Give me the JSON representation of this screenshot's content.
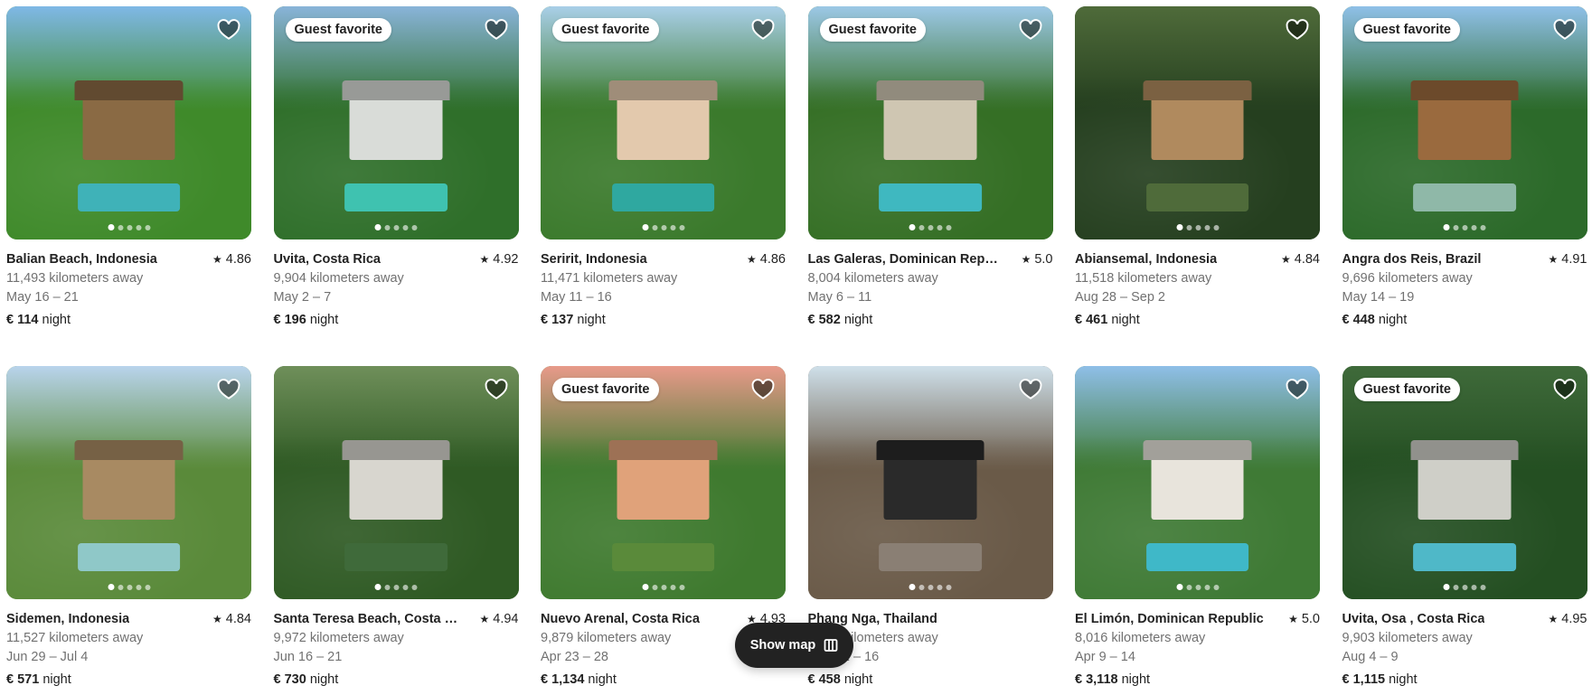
{
  "listings": [
    {
      "title": "Balian Beach, Indonesia",
      "rating": "4.86",
      "distance": "11,493 kilometers away",
      "dates": "May 16 – 21",
      "price": "€ 114",
      "price_unit": "night",
      "badge": "",
      "colors": {
        "sky": "#7fb8e6",
        "canopy": "#3f8a2a",
        "house": "#8a6a44",
        "pool": "#3fb2b8"
      }
    },
    {
      "title": "Uvita, Costa Rica",
      "rating": "4.92",
      "distance": "9,904 kilometers away",
      "dates": "May 2 – 7",
      "price": "€ 196",
      "price_unit": "night",
      "badge": "Guest favorite",
      "colors": {
        "sky": "#89b4d9",
        "canopy": "#2f6f2a",
        "house": "#d9dcd8",
        "pool": "#3fc2b0"
      }
    },
    {
      "title": "Seririt, Indonesia",
      "rating": "4.86",
      "distance": "11,471 kilometers away",
      "dates": "May 11 – 16",
      "price": "€ 137",
      "price_unit": "night",
      "badge": "Guest favorite",
      "colors": {
        "sky": "#a9cfe8",
        "canopy": "#3b7a2c",
        "house": "#e3c9ad",
        "pool": "#2fa8a0"
      }
    },
    {
      "title": "Las Galeras, Dominican Republic",
      "rating": "5.0",
      "distance": "8,004 kilometers away",
      "dates": "May 6 – 11",
      "price": "€ 582",
      "price_unit": "night",
      "badge": "Guest favorite",
      "colors": {
        "sky": "#9cc8e6",
        "canopy": "#356f25",
        "house": "#cfc6b2",
        "pool": "#3fb8c0"
      }
    },
    {
      "title": "Abiansemal, Indonesia",
      "rating": "4.84",
      "distance": "11,518 kilometers away",
      "dates": "Aug 28 – Sep 2",
      "price": "€ 461",
      "price_unit": "night",
      "badge": "",
      "colors": {
        "sky": "#4f6b3a",
        "canopy": "#253f1f",
        "house": "#b08a5e",
        "pool": "#4f6b3a"
      }
    },
    {
      "title": "Angra dos Reis, Brazil",
      "rating": "4.91",
      "distance": "9,696 kilometers away",
      "dates": "May 14 – 19",
      "price": "€ 448",
      "price_unit": "night",
      "badge": "Guest favorite",
      "colors": {
        "sky": "#8fc0e8",
        "canopy": "#2c6a2a",
        "house": "#9a6a3e",
        "pool": "#8fb8a8"
      }
    },
    {
      "title": "Sidemen, Indonesia",
      "rating": "4.84",
      "distance": "11,527 kilometers away",
      "dates": "Jun 29 – Jul 4",
      "price": "€ 571",
      "price_unit": "night",
      "badge": "",
      "colors": {
        "sky": "#b9d4ec",
        "canopy": "#5a8a3a",
        "house": "#a88a62",
        "pool": "#8fc8c8"
      }
    },
    {
      "title": "Santa Teresa Beach, Costa Rica",
      "rating": "4.94",
      "distance": "9,972 kilometers away",
      "dates": "Jun 16 – 21",
      "price": "€ 730",
      "price_unit": "night",
      "badge": "",
      "colors": {
        "sky": "#6f8f5a",
        "canopy": "#2f5a24",
        "house": "#d8d6cf",
        "pool": "#3f6a3a"
      }
    },
    {
      "title": "Nuevo Arenal, Costa Rica",
      "rating": "4.93",
      "distance": "9,879 kilometers away",
      "dates": "Apr 23 – 28",
      "price": "€ 1,134",
      "price_unit": "night",
      "badge": "Guest favorite",
      "colors": {
        "sky": "#e89a8a",
        "canopy": "#3f7a2f",
        "house": "#e0a27a",
        "pool": "#5a8a3a"
      }
    },
    {
      "title": "Phang Nga, Thailand",
      "rating": "",
      "distance": "9,996 kilometers away",
      "dates": "May 11 – 16",
      "price": "€ 458",
      "price_unit": "night",
      "badge": "",
      "colors": {
        "sky": "#cfe0ea",
        "canopy": "#6a5a48",
        "house": "#2a2a2a",
        "pool": "#8a7f74"
      }
    },
    {
      "title": "El Limón, Dominican Republic",
      "rating": "5.0",
      "distance": "8,016 kilometers away",
      "dates": "Apr 9 – 14",
      "price": "€ 3,118",
      "price_unit": "night",
      "badge": "",
      "colors": {
        "sky": "#8fbfe8",
        "canopy": "#3f7a35",
        "house": "#e8e4dc",
        "pool": "#3fb8c8"
      }
    },
    {
      "title": "Uvita, Osa , Costa Rica",
      "rating": "4.95",
      "distance": "9,903 kilometers away",
      "dates": "Aug 4 – 9",
      "price": "€ 1,115",
      "price_unit": "night",
      "badge": "Guest favorite",
      "colors": {
        "sky": "#3f6a3a",
        "canopy": "#244f22",
        "house": "#cfcfc8",
        "pool": "#4fb8c8"
      }
    }
  ],
  "show_map": {
    "label": "Show map",
    "icon": "map-icon"
  },
  "card_icons": {
    "wishlist": "heart-icon",
    "rating": "star-icon"
  }
}
